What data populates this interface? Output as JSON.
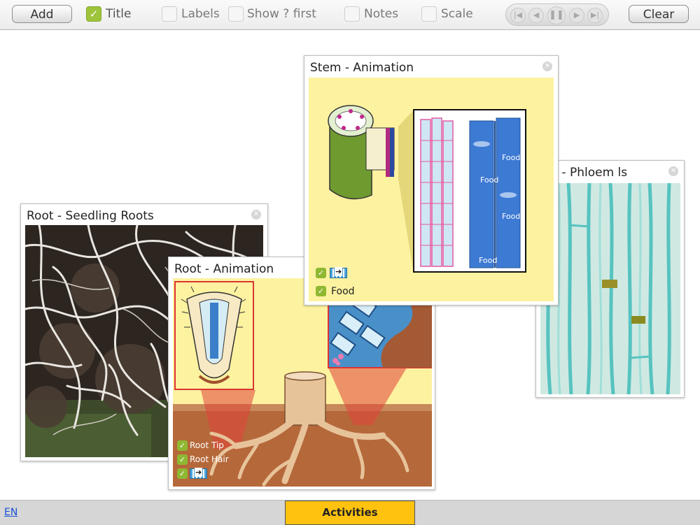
{
  "toolbar": {
    "add_label": "Add",
    "clear_label": "Clear",
    "checkboxes": [
      {
        "label": "Title",
        "checked": true
      },
      {
        "label": "Labels",
        "checked": false
      },
      {
        "label": "Show ? first",
        "checked": false
      },
      {
        "label": "Notes",
        "checked": false
      },
      {
        "label": "Scale",
        "checked": false
      }
    ]
  },
  "cards": {
    "seedling": {
      "title": "Root - Seedling Roots"
    },
    "root_anim": {
      "title": "Root - Animation",
      "checks": [
        {
          "label": "Root Tip",
          "checked": true
        },
        {
          "label": "Root Hair",
          "checked": true
        }
      ]
    },
    "stem_anim": {
      "title": "Stem - Animation",
      "food_check": {
        "label": "Food",
        "checked": true
      },
      "labels": [
        "Food",
        "Food",
        "Food",
        "Food"
      ]
    },
    "phloem": {
      "title": "em - Phloem ls"
    }
  },
  "footer": {
    "language": "EN",
    "activities_label": "Activities"
  },
  "colors": {
    "checkbox_green": "#9dc43a",
    "activities_yellow": "#ffc20e",
    "diagram_background": "#fdf2a0"
  },
  "icons": {
    "close": "close-icon",
    "check": "check-icon",
    "arrow": "arrow-right-icon",
    "skip_back": "skip-back-icon",
    "step_back": "step-back-icon",
    "pause": "pause-icon",
    "step_forward": "step-forward-icon",
    "skip_forward": "skip-forward-icon"
  }
}
